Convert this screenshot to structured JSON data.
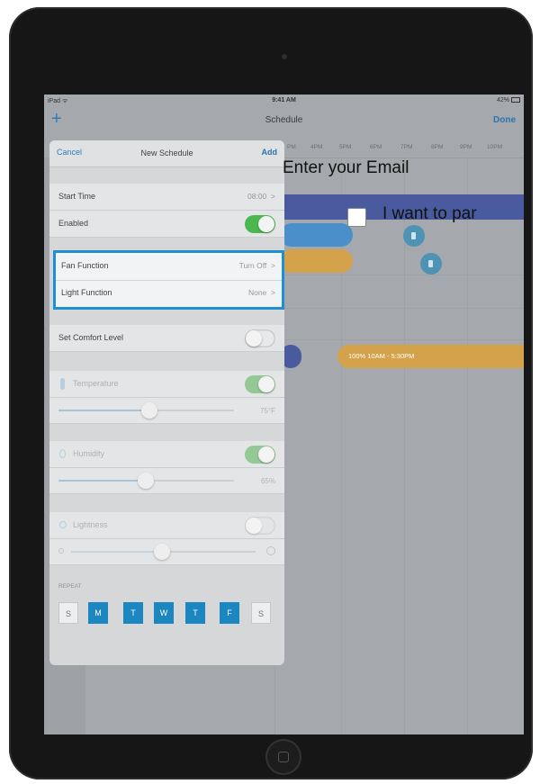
{
  "status_bar": {
    "carrier": "iPad ᯤ",
    "time": "9:41 AM",
    "battery": "42%"
  },
  "nav": {
    "add_symbol": "+",
    "title": "Schedule",
    "done_label": "Done"
  },
  "timeline": {
    "hours": [
      "PM",
      "4PM",
      "5PM",
      "6PM",
      "7PM",
      "8PM",
      "9PM",
      "10PM"
    ]
  },
  "schedule_bar": {
    "label": "100%  10AM - 5:30PM",
    "icon": "lightbulb-icon"
  },
  "sheet": {
    "cancel_label": "Cancel",
    "title": "New Schedule",
    "add_label": "Add",
    "start_time_label": "Start Time",
    "start_time_value": "08:00",
    "enabled_label": "Enabled",
    "fan_function_label": "Fan Function",
    "fan_function_value": "Turn Off",
    "light_function_label": "Light Function",
    "light_function_value": "None",
    "comfort_label": "Set Comfort Level",
    "temperature_label": "Temperature",
    "temperature_value": "75°F",
    "humidity_label": "Humidity",
    "humidity_value": "65%",
    "lightness_label": "Lightness",
    "repeat_label": "REPEAT",
    "days": [
      {
        "letter": "S",
        "selected": false
      },
      {
        "letter": "M",
        "selected": true
      },
      {
        "letter": "T",
        "selected": true
      },
      {
        "letter": "W",
        "selected": true
      },
      {
        "letter": "T",
        "selected": true
      },
      {
        "letter": "F",
        "selected": true
      },
      {
        "letter": "S",
        "selected": false
      }
    ],
    "chevron": ">"
  },
  "overlay": {
    "email_label": "Enter your Email",
    "consent_label": "I want to par"
  },
  "colors": {
    "accent_blue": "#1b86bf",
    "toggle_green": "#4bb84f",
    "bar_navy": "#4a5a9e",
    "bar_blue": "#4a8fc9",
    "bar_gold": "#d4a24a"
  }
}
